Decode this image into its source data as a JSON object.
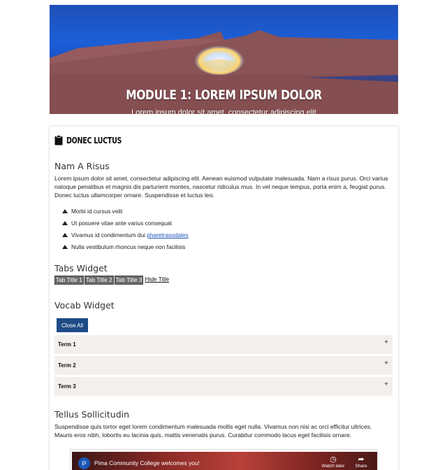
{
  "hero": {
    "title": "Module 1: Lorem ipsum dolor",
    "subtitle": "Lorem ipsum dolor sit amet, consectetur adipiscing elit"
  },
  "card": {
    "header_icon": "clipboard-icon",
    "title": "Donec Luctus"
  },
  "section1": {
    "heading": "Nam A Risus",
    "paragraph": "Lorem ipsum dolor sit amet, consectetur adipiscing elit. Aenean euismod vulputate malesuada. Nam a risus purus. Orci varius natoque penatibus et magnis dis parturient montes, nascetur ridiculus mus. In vel neque tempus, porta enim a, feugiat purus. Donec luctus ullamcorper ornare. Suspendisse et luctus leo.",
    "bullets": [
      {
        "text": "Morbi id cursus velit"
      },
      {
        "text": "Ut posuere vitae ante varius consequat"
      },
      {
        "text": "Vivamus id condimentum dui ",
        "link": "pharetrasodales"
      },
      {
        "text": "Nulla vestibulum rhoncus neque non facilisis"
      }
    ]
  },
  "tabs_widget": {
    "heading": "Tabs Widget",
    "tabs": [
      "Tab Title 1",
      "Tab Title 2",
      "Tab Title 3"
    ],
    "hide_label": "Hide Title"
  },
  "vocab_widget": {
    "heading": "Vocab Widget",
    "close_all_label": "Close All",
    "terms": [
      "Term 1",
      "Term 2",
      "Term 3"
    ],
    "expand_symbol": "+"
  },
  "section2": {
    "heading": "Tellus Sollicitudin",
    "paragraph": "Suspendisse quis tortor eget lorem condimentum malesuada mollis eget nulla. Vivamus non nisi ac orci efficitur ultrices. Mauris eros nibh, lobortis eu lacinia quis, mattis venenatis purus. Curabitur commodo lacus eget facilisis ornare."
  },
  "video": {
    "channel_initial": "P",
    "title": "Pima Community College welcomes you!",
    "watch_later_label": "Watch later",
    "share_label": "Share"
  },
  "colors": {
    "button_blue": "#1e4b86",
    "term_bg": "#f2efec",
    "tab_bg": "#6b6b6b",
    "link": "#1b52b8"
  }
}
